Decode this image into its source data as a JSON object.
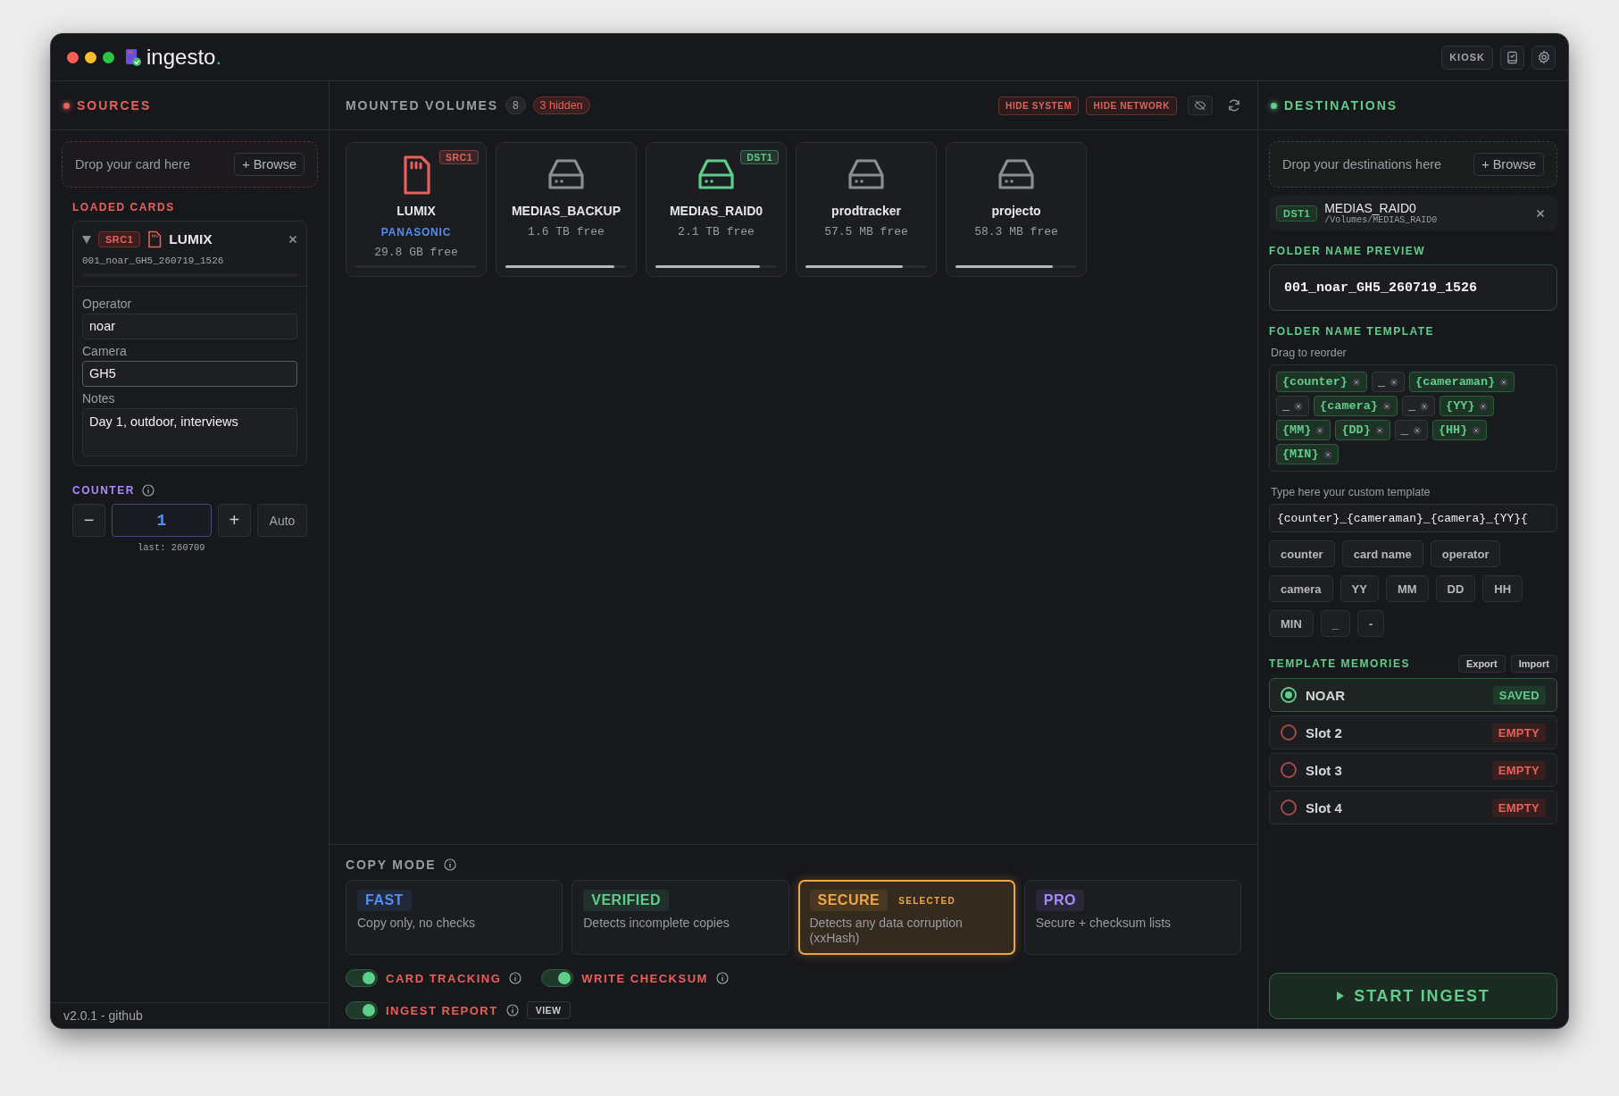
{
  "window": {
    "title": "ingesto",
    "title_dot": ".",
    "kiosk": "KIOSK"
  },
  "sources": {
    "title": "SOURCES",
    "drop_text": "Drop your card here",
    "browse": "+ Browse",
    "loaded_title": "LOADED CARDS",
    "cards": [
      {
        "badge": "SRC1",
        "name": "LUMIX",
        "expanded": true,
        "folder": "001_noar_GH5_260719_1526",
        "fields": [
          {
            "kind": "input",
            "label": "Operator",
            "value": "noar",
            "focused": false
          },
          {
            "kind": "input",
            "label": "Camera",
            "value": "GH5",
            "focused": true
          },
          {
            "kind": "textarea",
            "label": "Notes",
            "value": "Day 1, outdoor, interviews",
            "focused": false
          }
        ]
      }
    ],
    "counter": {
      "title": "COUNTER",
      "minus": "−",
      "value": "1",
      "plus": "+",
      "auto": "Auto",
      "last": "last: 260709"
    },
    "footer": "v2.0.1 - github"
  },
  "volumes": {
    "title": "MOUNTED VOLUMES",
    "count": "8",
    "hidden": "3 hidden",
    "hide_system": "HIDE SYSTEM",
    "hide_network": "HIDE NETWORK",
    "items": [
      {
        "kind": "card",
        "color": "#e8605a",
        "badge": "SRC1",
        "name": "LUMIX",
        "brand": "PANASONIC",
        "free": "29.8 GB free"
      },
      {
        "kind": "drive",
        "color": "#8b8d94",
        "name": "MEDIAS_BACKUP",
        "free": "1.6 TB free",
        "level": 0.9
      },
      {
        "kind": "drive",
        "color": "#5fce8a",
        "badge": "DST1",
        "name": "MEDIAS_RAID0",
        "free": "2.1 TB free",
        "level": 0.86
      },
      {
        "kind": "drive",
        "color": "#8b8d94",
        "name": "prodtracker",
        "free": "57.5 MB free",
        "level": 0.8
      },
      {
        "kind": "drive",
        "color": "#8b8d94",
        "name": "projecto",
        "free": "58.3 MB free",
        "level": 0.8
      }
    ]
  },
  "copy_mode": {
    "title": "COPY MODE",
    "modes": [
      {
        "name": "FAST",
        "desc": "Copy only, no checks",
        "color": "#4f8ff7",
        "selected": false
      },
      {
        "name": "VERIFIED",
        "desc": "Detects incomplete copies",
        "color": "#5fce8a",
        "selected": false
      },
      {
        "name": "SECURE",
        "desc": "Detects any data corruption (xxHash)",
        "color": "#f0a640",
        "selected": true,
        "tag": "SELECTED"
      },
      {
        "name": "PRO",
        "desc": "Secure + checksum lists",
        "color": "#a78bfa",
        "selected": false
      }
    ],
    "option_rows": [
      [
        {
          "label": "CARD TRACKING",
          "on": true
        },
        {
          "label": "WRITE CHECKSUM",
          "on": true
        }
      ],
      [
        {
          "label": "INGEST REPORT",
          "on": true,
          "action": "VIEW"
        }
      ]
    ]
  },
  "destinations": {
    "title": "DESTINATIONS",
    "drop_text": "Drop your destinations here",
    "browse": "+ Browse",
    "items": [
      {
        "badge": "DST1",
        "name": "MEDIAS_RAID0",
        "path": "/Volumes/MEDIAS_RAID0"
      }
    ],
    "preview_title": "FOLDER NAME PREVIEW",
    "preview": "001_noar_GH5_260719_1526",
    "template_title": "FOLDER NAME TEMPLATE",
    "template_hint": "Drag to reorder",
    "chips": [
      {
        "kind": "token",
        "text": "{counter}"
      },
      {
        "kind": "separator",
        "text": "_"
      },
      {
        "kind": "token",
        "text": "{cameraman}"
      },
      {
        "kind": "separator",
        "text": "_"
      },
      {
        "kind": "token",
        "text": "{camera}"
      },
      {
        "kind": "separator",
        "text": "_"
      },
      {
        "kind": "token",
        "text": "{YY}"
      },
      {
        "kind": "token",
        "text": "{MM}"
      },
      {
        "kind": "token",
        "text": "{DD}"
      },
      {
        "kind": "separator",
        "text": "_"
      },
      {
        "kind": "token",
        "text": "{HH}"
      },
      {
        "kind": "token",
        "text": "{MIN}"
      }
    ],
    "custom_label": "Type here your custom template",
    "custom_value": "{counter}_{cameraman}_{camera}_{YY}{",
    "inserts": [
      "counter",
      "card name",
      "operator",
      "camera",
      "YY",
      "MM",
      "DD",
      "HH",
      "MIN",
      "_",
      "-"
    ],
    "memories_title": "TEMPLATE MEMORIES",
    "export": "Export",
    "import": "Import",
    "memories": [
      {
        "name": "NOAR",
        "status": "SAVED",
        "kind": "saved",
        "selected": true
      },
      {
        "name": "Slot 2",
        "status": "EMPTY",
        "kind": "empty",
        "selected": false
      },
      {
        "name": "Slot 3",
        "status": "EMPTY",
        "kind": "empty",
        "selected": false
      },
      {
        "name": "Slot 4",
        "status": "EMPTY",
        "kind": "empty",
        "selected": false
      }
    ],
    "start": "START INGEST"
  }
}
